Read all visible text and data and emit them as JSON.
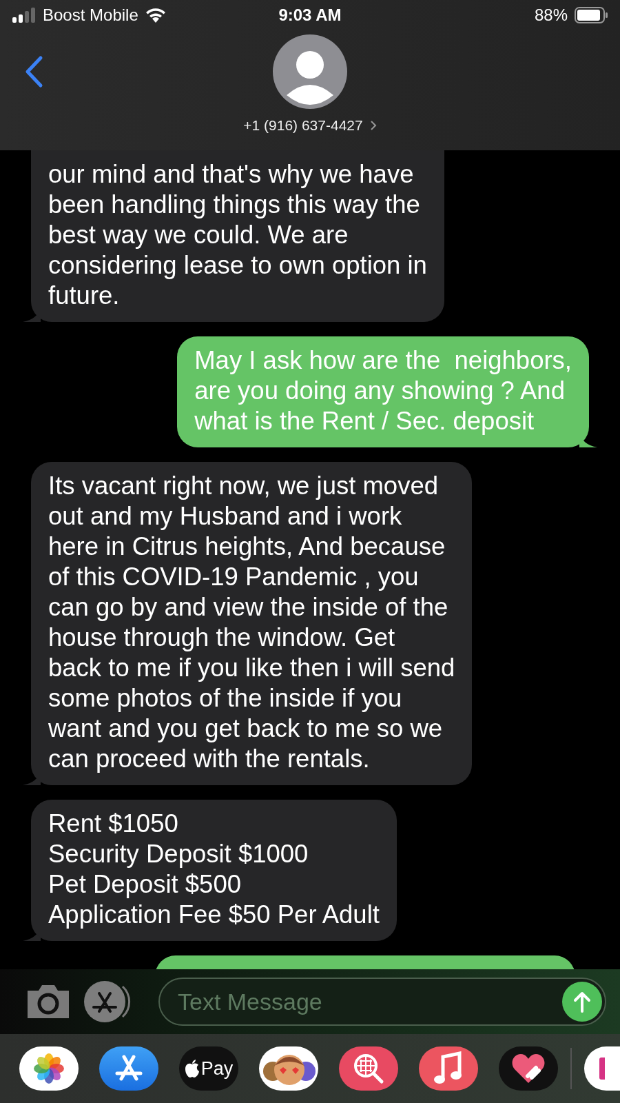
{
  "status_bar": {
    "carrier": "Boost Mobile",
    "time": "9:03 AM",
    "battery": "88%"
  },
  "header": {
    "contact": "+1 (916) 637-4427"
  },
  "messages": [
    {
      "kind": "received",
      "lines": [
        "our mind and that's why we have",
        "been handling things this way the",
        "best way we could. We are",
        "considering lease to own option in",
        "future."
      ]
    },
    {
      "kind": "sent",
      "lines": [
        "May I ask how are the  neighbors,",
        "are you doing any showing ? And",
        "what is the Rent / Sec. deposit"
      ]
    },
    {
      "kind": "received",
      "lines": [
        "Its vacant right now, we just moved",
        "out and my Husband and i work",
        "here in Citrus heights, And because",
        "of this COVID-19 Pandemic , you",
        "can go by and view the inside of the",
        "house through the window. Get",
        "back to me if you like then i will send",
        "some photos of the inside if you",
        "want and you get back to me so we",
        "can proceed with the rentals."
      ]
    },
    {
      "kind": "received",
      "lines": [
        "Rent $1050",
        "Security Deposit $1000",
        "Pet Deposit $500",
        "Application Fee $50 Per Adult"
      ]
    },
    {
      "kind": "sent"
    }
  ],
  "compose": {
    "placeholder": "Text Message"
  },
  "app_drawer": {
    "apple_pay_label": "Pay"
  }
}
